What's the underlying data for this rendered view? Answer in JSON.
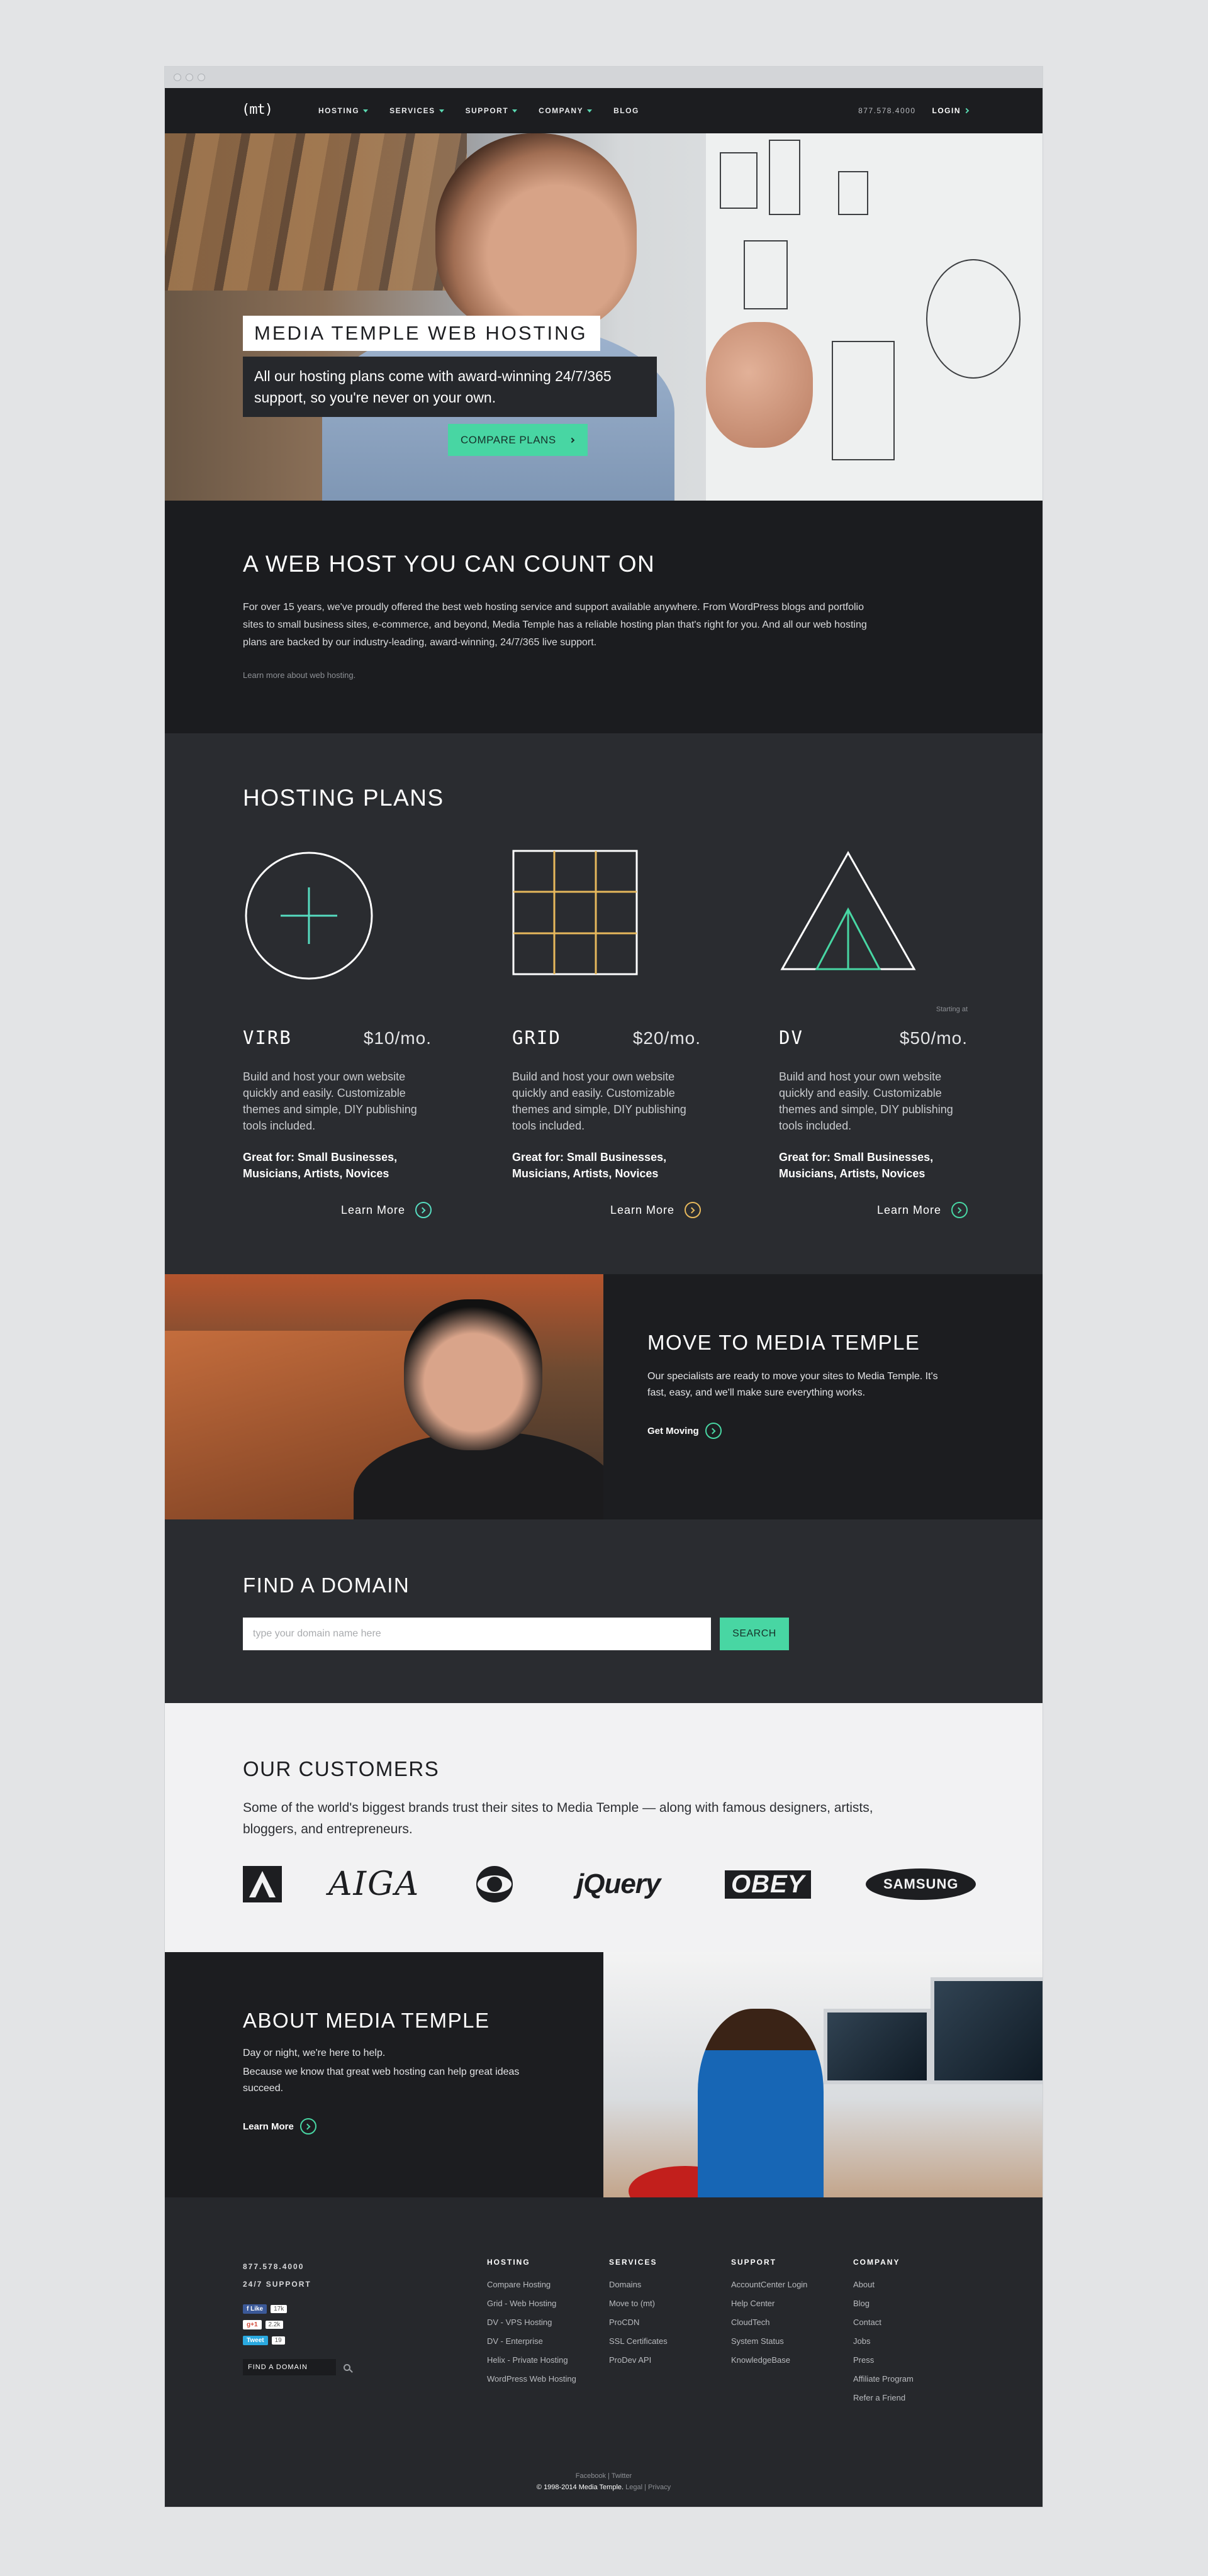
{
  "nav": {
    "logo": "(mt)",
    "items": [
      "HOSTING",
      "SERVICES",
      "SUPPORT",
      "COMPANY",
      "BLOG"
    ],
    "phone": "877.578.4000",
    "login": "LOGIN"
  },
  "hero": {
    "title": "MEDIA TEMPLE WEB HOSTING",
    "text": "All our hosting plans come with award-winning 24/7/365 support, so you're never on your own.",
    "button": "COMPARE PLANS"
  },
  "countOn": {
    "title": "A WEB HOST YOU CAN COUNT ON",
    "body": "For over 15 years, we've proudly offered the best web hosting service and support available anywhere. From WordPress blogs and portfolio sites to small business sites, e-commerce, and beyond, Media Temple has a reliable hosting plan that's right for you. And all our web hosting plans are backed by our industry-leading, award-winning, 24/7/365 live support.",
    "link": "Learn more about web hosting."
  },
  "plans": {
    "title": "HOSTING PLANS",
    "items": [
      {
        "name": "VIRB",
        "price": "$10/mo.",
        "pre": "",
        "desc": "Build and host your own website quickly and easily. Customizable themes and simple, DIY publishing tools included.",
        "great": "Great for: Small Businesses, Musicians, Artists, Novices",
        "more": "Learn More",
        "color": "#56dcc0"
      },
      {
        "name": "GRID",
        "price": "$20/mo.",
        "pre": "",
        "desc": "Build and host your own website quickly and easily. Customizable themes and simple, DIY publishing tools included.",
        "great": "Great for: Small Businesses, Musicians, Artists, Novices",
        "more": "Learn More",
        "color": "#e6b85c"
      },
      {
        "name": "DV",
        "price": "$50/mo.",
        "pre": "Starting at",
        "desc": "Build and host your own website quickly and easily. Customizable themes and simple, DIY publishing tools included.",
        "great": "Great for: Small Businesses, Musicians, Artists, Novices",
        "more": "Learn More",
        "color": "#48d6a3"
      }
    ]
  },
  "move": {
    "title": "MOVE TO MEDIA TEMPLE",
    "text": "Our specialists are ready to move your sites to Media Temple. It's fast, easy, and we'll make sure everything works.",
    "link": "Get Moving"
  },
  "domain": {
    "title": "FIND A DOMAIN",
    "placeholder": "type your domain name here",
    "button": "SEARCH"
  },
  "customers": {
    "title": "OUR CUSTOMERS",
    "text": "Some of the world's biggest brands trust their sites to Media Temple — along with famous designers, artists, bloggers, and entrepreneurs.",
    "logos": [
      "Adobe",
      "AIGA",
      "CBS",
      "jQuery",
      "OBEY",
      "SAMSUNG"
    ],
    "logo_text": {
      "aiga": "AIGA",
      "jquery": "jQuery",
      "obey": "OBEY",
      "samsung": "SAMSUNG"
    }
  },
  "about": {
    "title": "ABOUT MEDIA TEMPLE",
    "p1": "Day or night, we're here to help.",
    "p2": "Because we know that great web hosting can help great ideas succeed.",
    "link": "Learn More"
  },
  "footer": {
    "phone": "877.578.4000",
    "support": "24/7 SUPPORT",
    "social": [
      {
        "label": "f Like",
        "count": "17k",
        "bg": "#3b5998",
        "fg": "#ffffff"
      },
      {
        "label": "g+1",
        "count": "2.2k",
        "bg": "#ffffff",
        "fg": "#d14836"
      },
      {
        "label": "Tweet",
        "count": "19",
        "bg": "#2aa9e0",
        "fg": "#ffffff"
      }
    ],
    "findDomain": "FIND A DOMAIN",
    "columns": [
      {
        "title": "HOSTING",
        "links": [
          "Compare Hosting",
          "Grid - Web Hosting",
          "DV - VPS Hosting",
          "DV - Enterprise",
          "Helix - Private Hosting",
          "WordPress Web Hosting"
        ]
      },
      {
        "title": "SERVICES",
        "links": [
          "Domains",
          "Move to (mt)",
          "ProCDN",
          "SSL Certificates",
          "ProDev API"
        ]
      },
      {
        "title": "SUPPORT",
        "links": [
          "AccountCenter Login",
          "Help Center",
          "CloudTech",
          "System Status",
          "KnowledgeBase"
        ]
      },
      {
        "title": "COMPANY",
        "links": [
          "About",
          "Blog",
          "Contact",
          "Jobs",
          "Press",
          "Affiliate Program",
          "Refer a Friend"
        ]
      }
    ],
    "social_links": "Facebook | Twitter",
    "copyright": "© 1998-2014 Media Temple.",
    "legal": "Legal | Privacy"
  },
  "colors": {
    "accent": "#48d6a3",
    "dark": "#1c1d20",
    "panel": "#2a2c30"
  }
}
